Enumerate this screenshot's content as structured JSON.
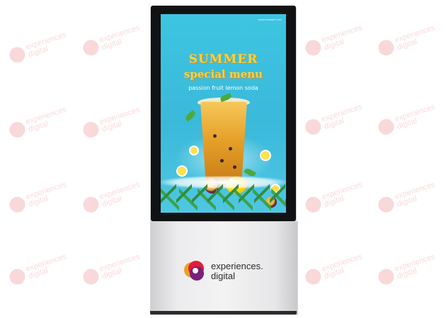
{
  "watermark": {
    "line1": "experiences",
    "line2": "digital",
    "color": "#e02b38"
  },
  "screen": {
    "tiny_text": "www.example.com",
    "title_line1": "SUMMER",
    "title_line2": "special menu",
    "subtitle": "passion fruit lemon soda",
    "background": "#3cc5e0"
  },
  "base_logo": {
    "line1": "experiences.",
    "line2": "digital"
  }
}
